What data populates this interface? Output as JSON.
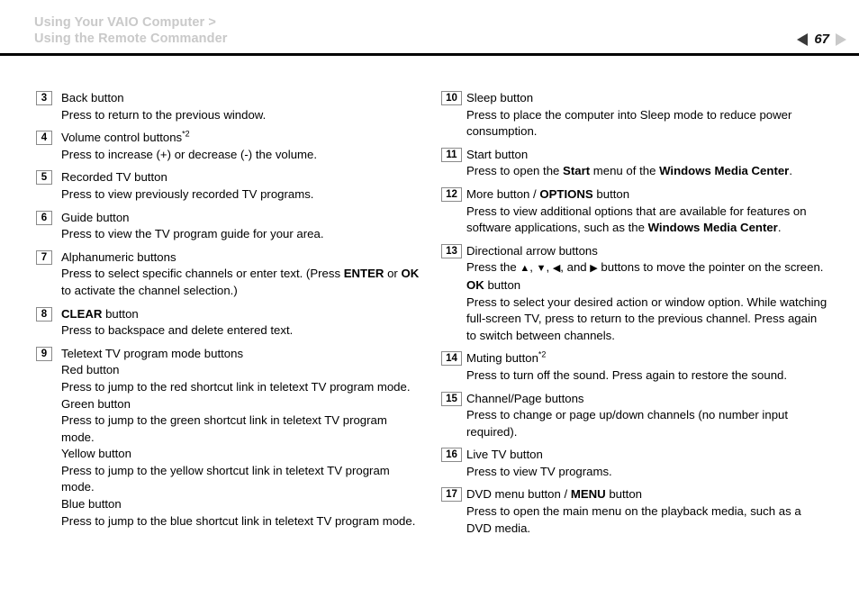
{
  "header": {
    "breadcrumb_line1": "Using Your VAIO Computer >",
    "breadcrumb_line2": "Using the Remote Commander",
    "page_number": "67",
    "prev_arrow_icon": "triangle-left-icon",
    "next_arrow_icon": "triangle-right-icon",
    "breadcrumb_color": "#c9c9c9",
    "prev_arrow_color": "#3a3a3a",
    "next_arrow_color": "#c9c9c9",
    "rule_color": "#000000"
  },
  "left_column": {
    "entries": [
      {
        "number": "3",
        "lines": [
          "Back button",
          "Press to return to the previous window."
        ]
      },
      {
        "number": "4",
        "lines": [
          "Volume control buttons<sup>*2</sup>",
          "Press to increase (+) or decrease (-) the volume."
        ]
      },
      {
        "number": "5",
        "lines": [
          "Recorded TV button",
          "Press to view previously recorded TV programs."
        ]
      },
      {
        "number": "6",
        "lines": [
          "Guide button",
          "Press to view the TV program guide for your area."
        ]
      },
      {
        "number": "7",
        "lines": [
          "Alphanumeric buttons",
          "Press to select specific channels or enter text. (Press <b>ENTER</b> or <b>OK</b> to activate the channel selection.)"
        ]
      },
      {
        "number": "8",
        "lines": [
          "<b>CLEAR</b> button",
          "Press to backspace and delete entered text."
        ]
      },
      {
        "number": "9",
        "lines": [
          "Teletext TV program mode buttons",
          "Red button",
          "Press to jump to the red shortcut link in teletext TV program mode.",
          "Green button",
          "Press to jump to the green shortcut link in teletext TV program mode.",
          "Yellow button",
          "Press to jump to the yellow shortcut link in teletext TV program mode.",
          "Blue button",
          "Press to jump to the blue shortcut link in teletext TV program mode."
        ]
      }
    ]
  },
  "right_column": {
    "entries": [
      {
        "number": "10",
        "lines": [
          "Sleep button",
          "Press to place the computer into Sleep mode to reduce power consumption."
        ]
      },
      {
        "number": "11",
        "lines": [
          "Start button",
          "Press to open the <b>Start</b> menu of the <b>Windows Media Center</b>."
        ]
      },
      {
        "number": "12",
        "lines": [
          "More button / <b>OPTIONS</b> button",
          "Press to view additional options that are available for features on software applications, such as the <b>Windows Media Center</b>."
        ]
      },
      {
        "number": "13",
        "lines": [
          "Directional arrow buttons",
          "Press the <span class=\"arrow-glyph\">&#9650;</span>, <span class=\"arrow-glyph\">&#9660;</span>, <span class=\"arrow-glyph\">&#9664;</span>, and <span class=\"arrow-glyph\">&#9654;</span> buttons to move the pointer on the screen.",
          "<b>OK</b> button",
          "Press to select your desired action or window option. While watching full-screen TV, press to return to the previous channel. Press again to switch between channels."
        ]
      },
      {
        "number": "14",
        "lines": [
          "Muting button<sup>*2</sup>",
          "Press to turn off the sound. Press again to restore the sound."
        ]
      },
      {
        "number": "15",
        "lines": [
          "Channel/Page buttons",
          "Press to change or page up/down channels (no number input required)."
        ]
      },
      {
        "number": "16",
        "lines": [
          "Live TV button",
          "Press to view TV programs."
        ]
      },
      {
        "number": "17",
        "lines": [
          "DVD menu button / <b>MENU</b> button",
          "Press to open the main menu on the playback media, such as a DVD media."
        ]
      }
    ]
  }
}
